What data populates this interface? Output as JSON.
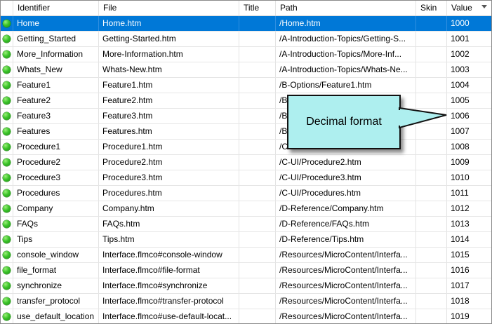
{
  "columns": {
    "identifier": "Identifier",
    "file": "File",
    "title": "Title",
    "path": "Path",
    "skin": "Skin",
    "value": "Value"
  },
  "rows": [
    {
      "identifier": "Home",
      "file": "Home.htm",
      "title": "",
      "path": "/Home.htm",
      "skin": "",
      "value": "1000",
      "selected": true
    },
    {
      "identifier": "Getting_Started",
      "file": "Getting-Started.htm",
      "title": "",
      "path": "/A-Introduction-Topics/Getting-S...",
      "skin": "",
      "value": "1001"
    },
    {
      "identifier": "More_Information",
      "file": "More-Information.htm",
      "title": "",
      "path": "/A-Introduction-Topics/More-Inf...",
      "skin": "",
      "value": "1002"
    },
    {
      "identifier": "Whats_New",
      "file": "Whats-New.htm",
      "title": "",
      "path": "/A-Introduction-Topics/Whats-Ne...",
      "skin": "",
      "value": "1003"
    },
    {
      "identifier": "Feature1",
      "file": "Feature1.htm",
      "title": "",
      "path": "/B-Options/Feature1.htm",
      "skin": "",
      "value": "1004"
    },
    {
      "identifier": "Feature2",
      "file": "Feature2.htm",
      "title": "",
      "path": "/B",
      "skin": "",
      "value": "1005"
    },
    {
      "identifier": "Feature3",
      "file": "Feature3.htm",
      "title": "",
      "path": "/B",
      "skin": "",
      "value": "1006"
    },
    {
      "identifier": "Features",
      "file": "Features.htm",
      "title": "",
      "path": "/B",
      "skin": "",
      "value": "1007"
    },
    {
      "identifier": "Procedure1",
      "file": "Procedure1.htm",
      "title": "",
      "path": "/C-UI/Procedure1.htm",
      "skin": "",
      "value": "1008"
    },
    {
      "identifier": "Procedure2",
      "file": "Procedure2.htm",
      "title": "",
      "path": "/C-UI/Procedure2.htm",
      "skin": "",
      "value": "1009"
    },
    {
      "identifier": "Procedure3",
      "file": "Procedure3.htm",
      "title": "",
      "path": "/C-UI/Procedure3.htm",
      "skin": "",
      "value": "1010"
    },
    {
      "identifier": "Procedures",
      "file": "Procedures.htm",
      "title": "",
      "path": "/C-UI/Procedures.htm",
      "skin": "",
      "value": "1011"
    },
    {
      "identifier": "Company",
      "file": "Company.htm",
      "title": "",
      "path": "/D-Reference/Company.htm",
      "skin": "",
      "value": "1012"
    },
    {
      "identifier": "FAQs",
      "file": "FAQs.htm",
      "title": "",
      "path": "/D-Reference/FAQs.htm",
      "skin": "",
      "value": "1013"
    },
    {
      "identifier": "Tips",
      "file": "Tips.htm",
      "title": "",
      "path": "/D-Reference/Tips.htm",
      "skin": "",
      "value": "1014"
    },
    {
      "identifier": "console_window",
      "file": "Interface.flmco#console-window",
      "title": "",
      "path": "/Resources/MicroContent/Interfa...",
      "skin": "",
      "value": "1015"
    },
    {
      "identifier": "file_format",
      "file": "Interface.flmco#file-format",
      "title": "",
      "path": "/Resources/MicroContent/Interfa...",
      "skin": "",
      "value": "1016"
    },
    {
      "identifier": "synchronize",
      "file": "Interface.flmco#synchronize",
      "title": "",
      "path": "/Resources/MicroContent/Interfa...",
      "skin": "",
      "value": "1017"
    },
    {
      "identifier": "transfer_protocol",
      "file": "Interface.flmco#transfer-protocol",
      "title": "",
      "path": "/Resources/MicroContent/Interfa...",
      "skin": "",
      "value": "1018"
    },
    {
      "identifier": "use_default_location",
      "file": "Interface.flmco#use-default-locat...",
      "title": "",
      "path": "/Resources/MicroContent/Interfa...",
      "skin": "",
      "value": "1019"
    }
  ],
  "callout": {
    "text": "Decimal format"
  },
  "colors": {
    "selection": "#0078d7",
    "callout_fill": "#aeefef",
    "status_green": "#3cc42a"
  },
  "icons": {
    "status": "green-status-dot-icon",
    "sort": "sort-descending-icon"
  }
}
